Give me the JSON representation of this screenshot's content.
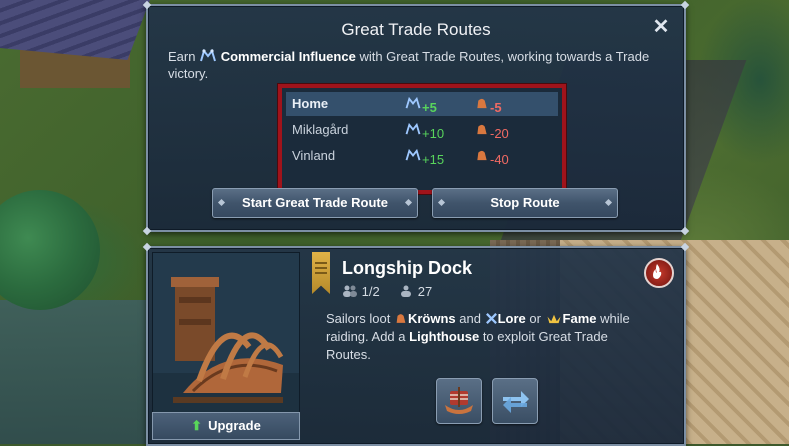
{
  "trade_panel": {
    "title": "Great Trade Routes",
    "close_label": "✕",
    "description_prefix": "Earn",
    "description_term": "Commercial Influence",
    "description_suffix": "with Great Trade Routes, working towards a Trade victory.",
    "routes": [
      {
        "name": "Home",
        "influence": "+5",
        "cost": "-5",
        "selected": true
      },
      {
        "name": "Miklagård",
        "influence": "+10",
        "cost": "-20",
        "selected": false
      },
      {
        "name": "Vinland",
        "influence": "+15",
        "cost": "-40",
        "selected": false
      }
    ],
    "start_button": "Start Great Trade Route",
    "stop_button": "Stop Route"
  },
  "building_panel": {
    "title": "Longship Dock",
    "workers": "1/2",
    "population": "27",
    "desc_1": "Sailors loot",
    "desc_krowns": "Kröwns",
    "desc_2": "and",
    "desc_lore": "Lore",
    "desc_3": "or",
    "desc_fame": "Fame",
    "desc_4": "while raiding. Add a",
    "desc_lighthouse": "Lighthouse",
    "desc_5": "to exploit Great Trade Routes.",
    "upgrade_label": "Upgrade",
    "icons": {
      "fire": "fire-icon",
      "ship": "longship-icon",
      "swap": "swap-icon"
    }
  },
  "colors": {
    "positive": "#58d45c",
    "negative": "#f06a63",
    "highlight": "#a0131b"
  }
}
